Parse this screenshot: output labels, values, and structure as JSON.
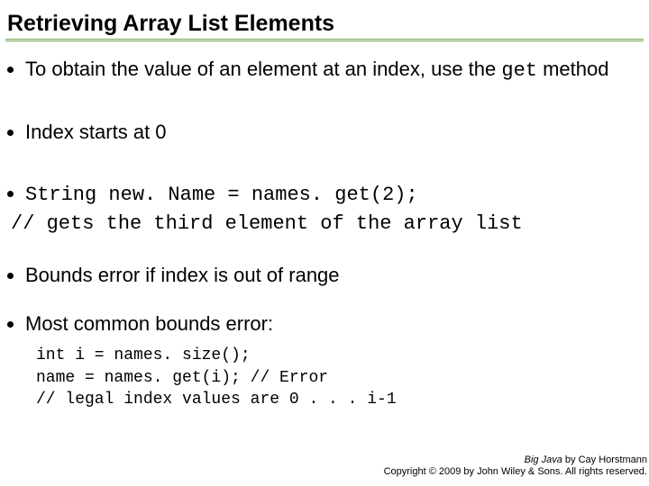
{
  "title": "Retrieving Array List Elements",
  "bullets": {
    "b1_pre": "To obtain the value of an element at an index, use the ",
    "b1_code": "get",
    "b1_post": " method",
    "b2": "Index starts at 0",
    "b3_code": "String new. Name = names. get(2);",
    "b3_comment": "// gets the third element of the array list",
    "b4": "Bounds error if index is out of range",
    "b5": "Most common bounds error:"
  },
  "codeblock": "int i = names. size();\nname = names. get(i); // Error\n// legal index values are 0 . . . i-1",
  "footer": {
    "line1_book": "Big Java",
    "line1_rest": " by Cay Horstmann",
    "line2": "Copyright © 2009 by John Wiley & Sons. All rights reserved."
  }
}
